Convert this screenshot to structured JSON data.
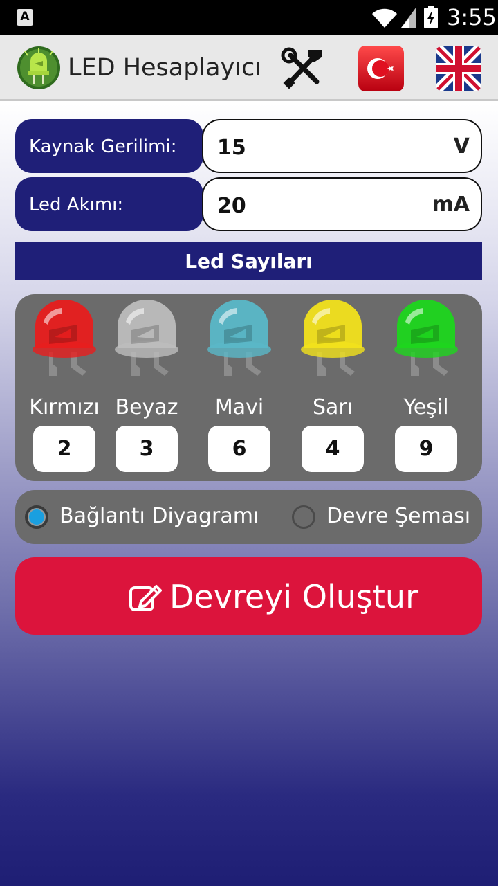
{
  "status_bar": {
    "left_icon_letter": "A",
    "icons": [
      "wifi-icon",
      "signal-icon",
      "battery-charging-icon"
    ],
    "time": "3:55"
  },
  "action_bar": {
    "title": "LED Hesaplayıcı",
    "icons": [
      "led-app-icon",
      "tools-icon",
      "turkey-flag-icon",
      "uk-flag-icon"
    ]
  },
  "inputs": {
    "source_voltage": {
      "label": "Kaynak Gerilimi:",
      "value": "15",
      "unit": "V"
    },
    "led_current": {
      "label": "Led Akımı:",
      "value": "20",
      "unit": "mA"
    }
  },
  "led_section": {
    "title": "Led Sayıları",
    "leds": [
      {
        "name": "Kırmızı",
        "count": "2",
        "color": "#e81e1e"
      },
      {
        "name": "Beyaz",
        "count": "3",
        "color": "#bdbdbd"
      },
      {
        "name": "Mavi",
        "count": "6",
        "color": "#5ab8c8"
      },
      {
        "name": "Sarı",
        "count": "4",
        "color": "#f2e21c"
      },
      {
        "name": "Yeşil",
        "count": "9",
        "color": "#1ed61e"
      }
    ]
  },
  "output_mode": {
    "options": [
      {
        "label": "Bağlantı Diyagramı",
        "selected": true
      },
      {
        "label": "Devre Şeması",
        "selected": false
      }
    ]
  },
  "create_button": {
    "label": "Devreyi Oluştur",
    "icon": "edit-icon"
  },
  "colors": {
    "navy": "#1f1f78",
    "panel_gray": "#6b6b6b",
    "create_red": "#dc143c",
    "radio_selected": "#1a9fe0"
  }
}
